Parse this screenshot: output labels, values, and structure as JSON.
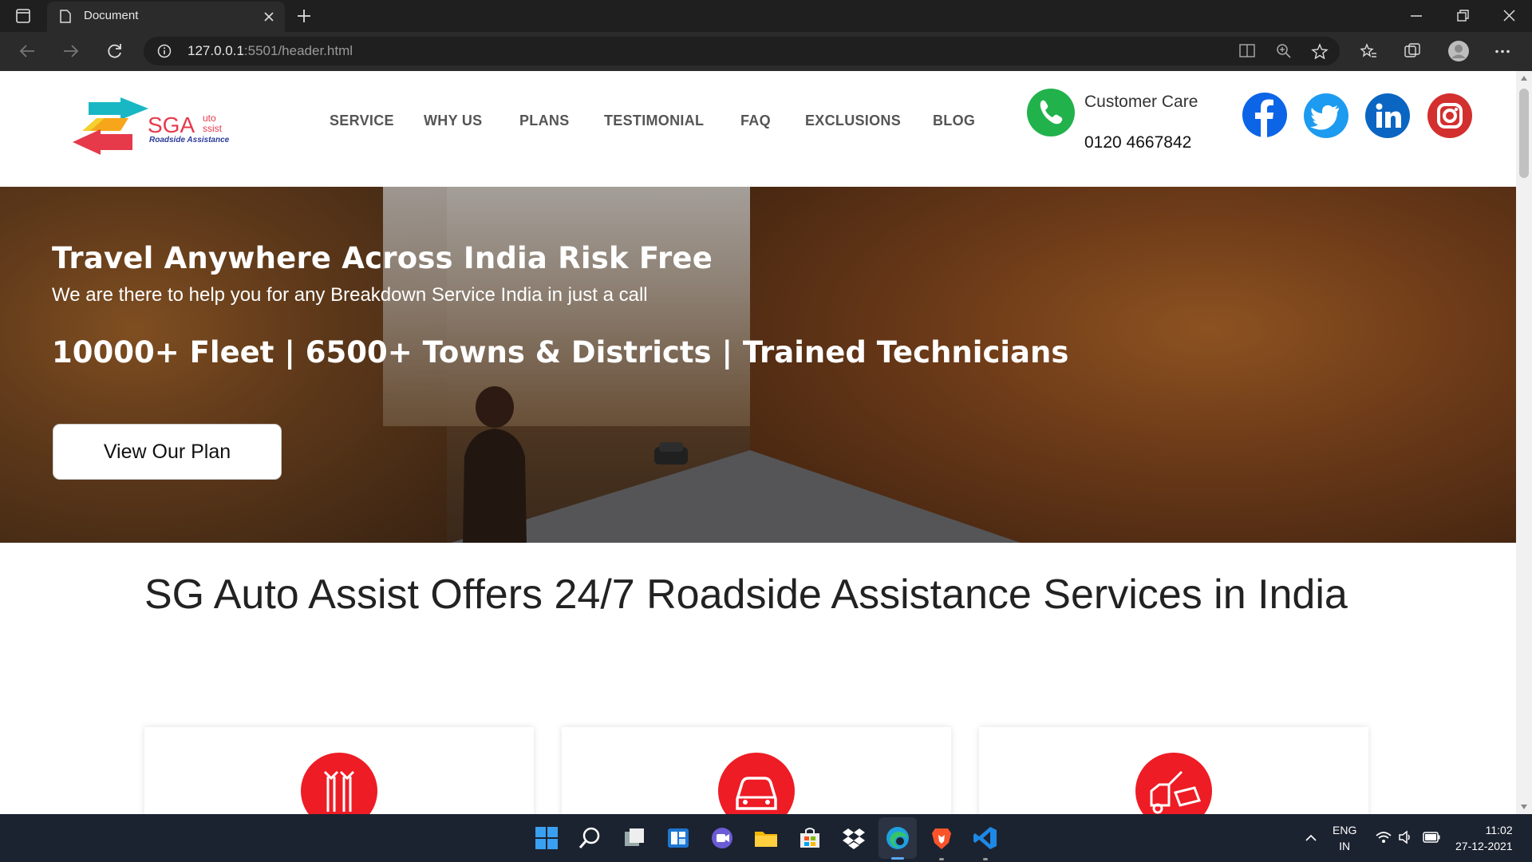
{
  "browser": {
    "tab_title": "Document",
    "url_host": "127.0.0.1",
    "url_rest": ":5501/header.html"
  },
  "header": {
    "logo_text": "SGA",
    "logo_sup": "uto",
    "logo_sub": "ssist",
    "logo_tag": "Roadside Assistance",
    "nav": [
      "SERVICE",
      "WHY US",
      "PLANS",
      "TESTIMONIAL",
      "FAQ",
      "EXCLUSIONS",
      "BLOG"
    ],
    "customer_care_label": "Customer Care",
    "customer_care_phone": "0120 4667842",
    "social": [
      "facebook-icon",
      "twitter-icon",
      "linkedin-icon",
      "instagram-icon"
    ]
  },
  "hero": {
    "title": "Travel Anywhere Across India Risk Free",
    "subtitle": "We are there to help you for any Breakdown Service India in just a call",
    "stats": "10000+ Fleet | 6500+ Towns & Districts | Trained Technicians",
    "button_label": "View Our Plan"
  },
  "main": {
    "headline": "SG Auto Assist Offers 24/7 Roadside Assistance Services in India"
  },
  "taskbar": {
    "lang_top": "ENG",
    "lang_bottom": "IN",
    "time": "11:02",
    "date": "27-12-2021"
  },
  "colors": {
    "accent_red": "#ee1c25",
    "facebook": "#0b65e6",
    "twitter": "#1d9bf0",
    "linkedin": "#0a66c2",
    "instagram": "#d32f2f",
    "phone_green": "#22b24c"
  }
}
